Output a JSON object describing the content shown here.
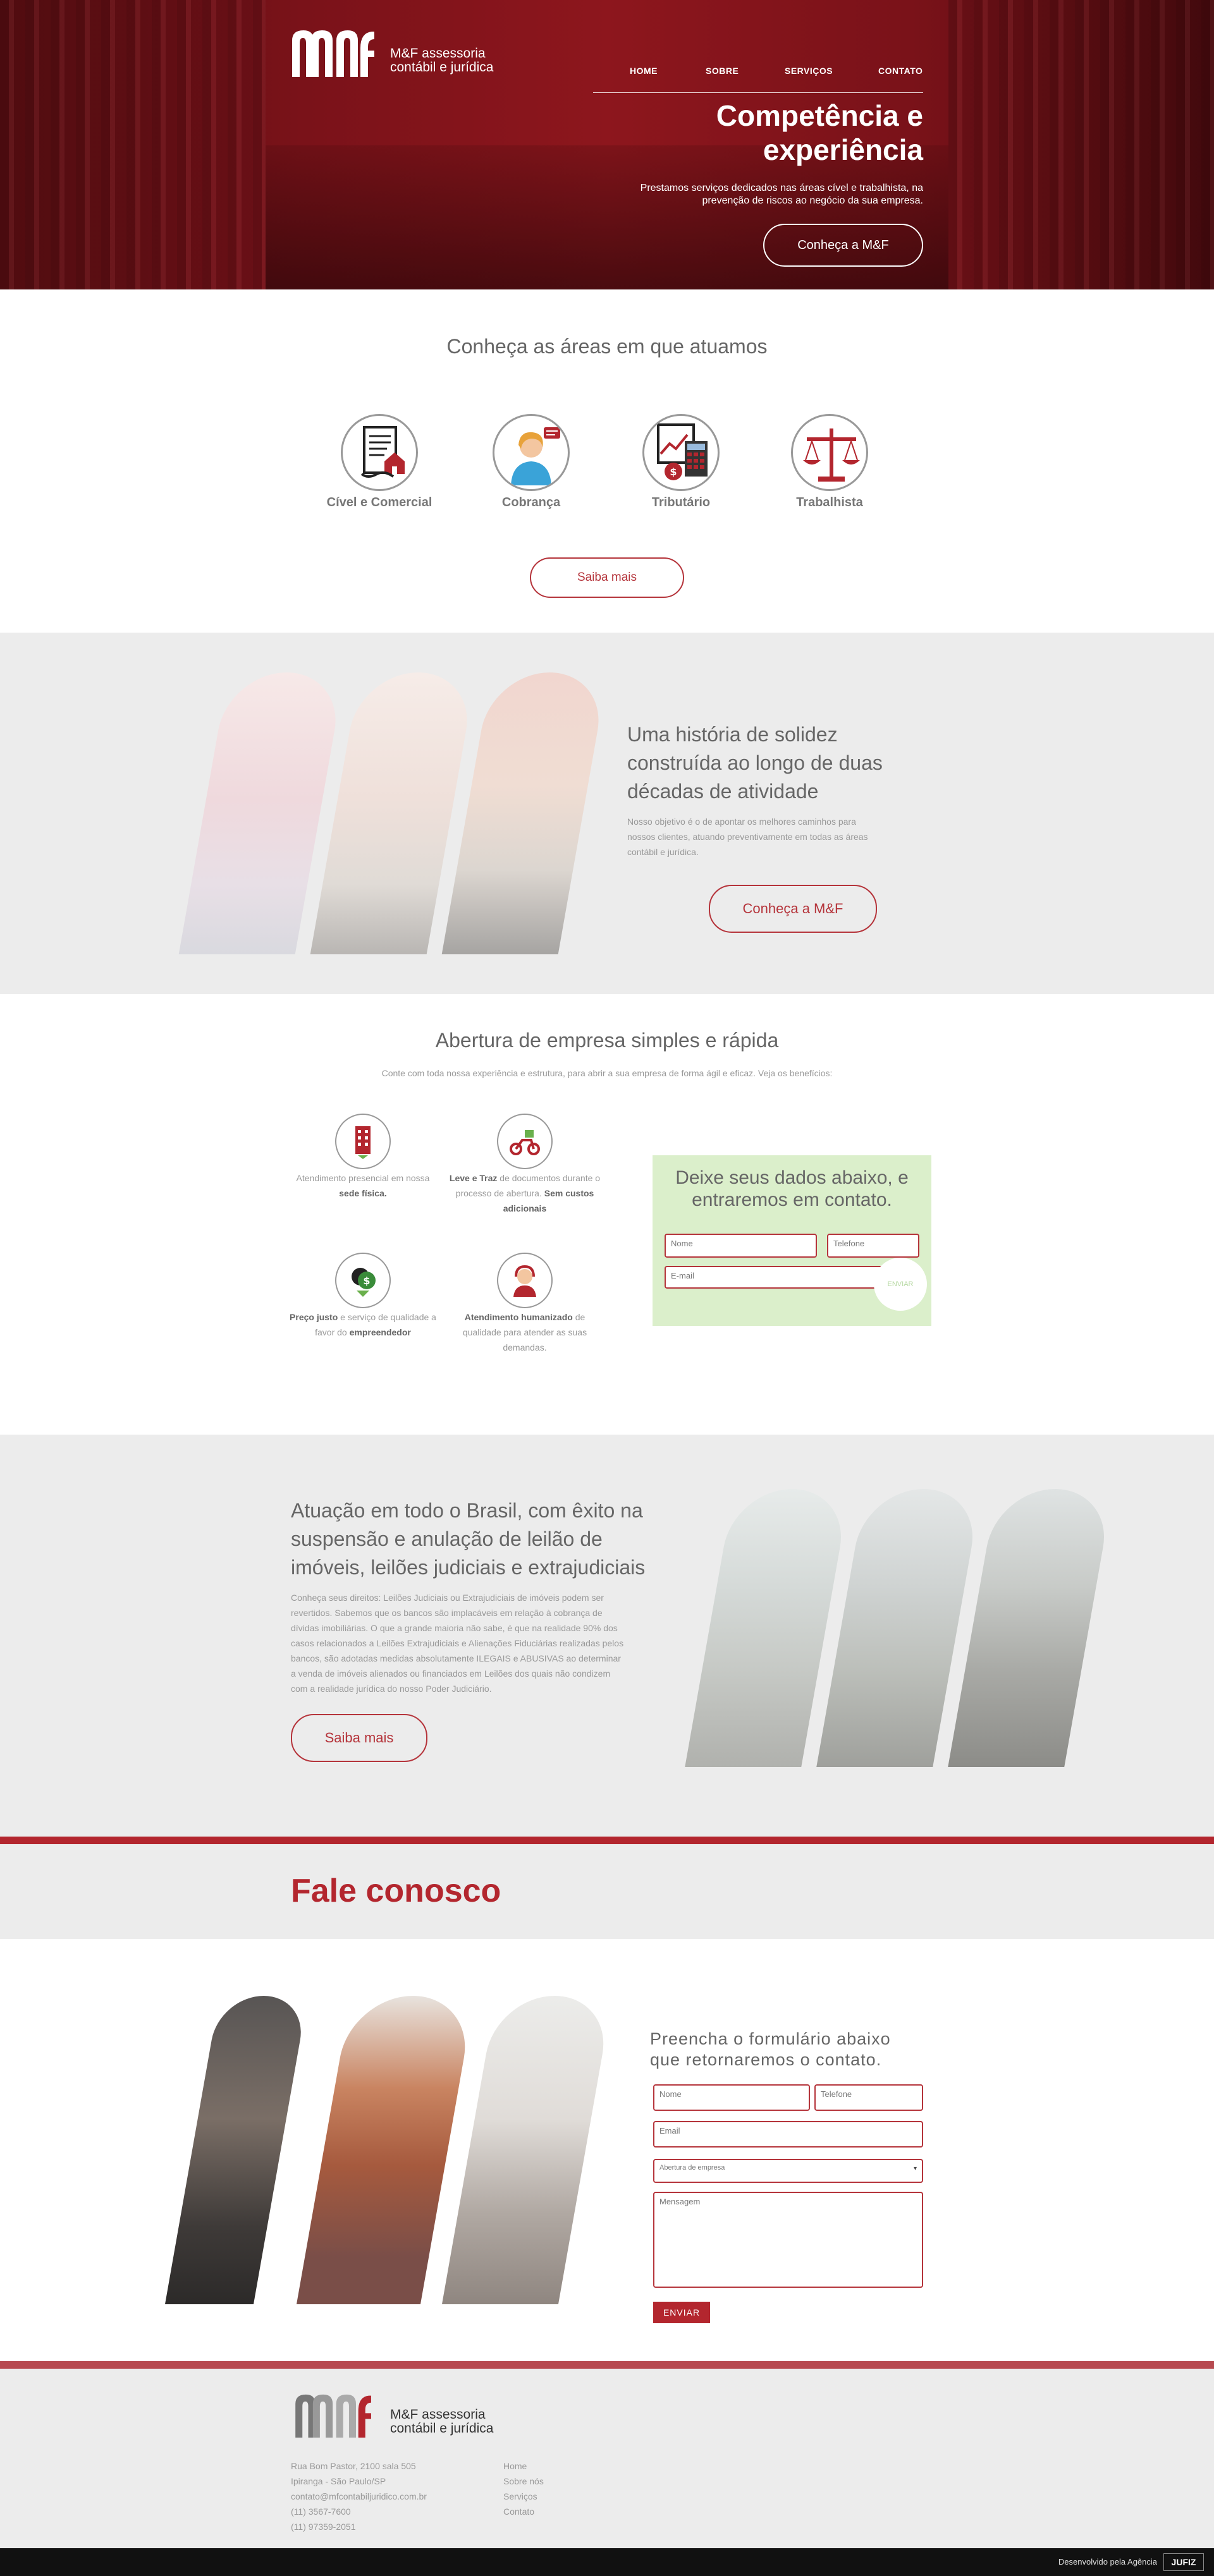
{
  "brand": {
    "logo_letters": "mf",
    "name_line1": "M&F assessoria",
    "name_line2": "contábil e jurídica"
  },
  "nav": {
    "items": [
      {
        "label": "HOME"
      },
      {
        "label": "SOBRE"
      },
      {
        "label": "SERVIÇOS"
      },
      {
        "label": "CONTATO"
      }
    ]
  },
  "hero": {
    "title_line1": "Competência e",
    "title_line2": "experiência",
    "subtitle_line1": "Prestamos serviços dedicados nas áreas cível e trabalhista, na",
    "subtitle_line2": "prevenção de riscos ao negócio da sua empresa.",
    "button": "Conheça a M&F"
  },
  "areas": {
    "title": "Conheça as áreas em que atuamos",
    "items": [
      {
        "label": "Cível e Comercial",
        "icon": "contract-house-icon"
      },
      {
        "label": "Cobrança",
        "icon": "collector-person-icon"
      },
      {
        "label": "Tributário",
        "icon": "calculator-document-icon"
      },
      {
        "label": "Trabalhista",
        "icon": "scales-icon"
      }
    ],
    "button": "Saiba mais"
  },
  "historia": {
    "title_line1": "Uma história de solidez",
    "title_line2": "construída ao longo de duas",
    "title_line3": "décadas de atividade",
    "text_line1": "Nosso objetivo é o de apontar os melhores caminhos para",
    "text_line2": "nossos clientes, atuando preventivamente em todas as áreas",
    "text_line3": "contábil e jurídica.",
    "button": "Conheça a M&F"
  },
  "abertura": {
    "title": "Abertura de empresa simples e rápida",
    "subtitle": "Conte com toda nossa experiência e estrutura, para abrir a sua empresa de forma ágil e eficaz. Veja os benefícios:",
    "features": [
      {
        "pre": "Atendimento presencial em nossa ",
        "bold": "sede física.",
        "post": "",
        "bold2": ""
      },
      {
        "pre": "",
        "bold": "Leve e Traz",
        "post": " de documentos durante o processo de abertura. ",
        "bold2": "Sem custos adicionais"
      },
      {
        "pre": "",
        "bold": "Preço justo",
        "post": " e serviço de qualidade a favor do ",
        "bold2": "empreendedor"
      },
      {
        "pre": "",
        "bold": "Atendimento humanizado",
        "post": " de qualidade para atender as suas demandas.",
        "bold2": ""
      }
    ],
    "form": {
      "title_line1": "Deixe seus dados abaixo, e",
      "title_line2": "entraremos em contato.",
      "name_placeholder": "Nome",
      "phone_placeholder": "Telefone",
      "email_placeholder": "E-mail",
      "send": "ENVIAR"
    }
  },
  "atuacao": {
    "title_line1": "Atuação em todo o Brasil, com êxito na",
    "title_line2": "suspensão e anulação de leilão de",
    "title_line3": "imóveis, leilões judiciais e extrajudiciais",
    "text": [
      "Conheça seus direitos: Leilões Judiciais ou Extrajudiciais de imóveis podem ser",
      "revertidos. Sabemos que os bancos são implacáveis em relação à cobrança de",
      "dívidas imobiliárias. O que a grande maioria não sabe, é que na realidade 90% dos",
      "casos relacionados a Leilões Extrajudiciais e Alienações Fiduciárias realizadas pelos",
      "bancos, são adotadas medidas absolutamente ILEGAIS e ABUSIVAS ao determinar",
      "a venda de imóveis alienados ou financiados em Leilões dos quais não condizem",
      "com a realidade jurídica do nosso Poder Judiciário."
    ],
    "button": "Saiba mais"
  },
  "fale": {
    "title": "Fale conosco",
    "form_title_line1": "Preencha o formulário abaixo",
    "form_title_line2": "que retornaremos o contato.",
    "name_placeholder": "Nome",
    "phone_placeholder": "Telefone",
    "email_placeholder": "Email",
    "subject_selected": "Abertura de empresa",
    "message_placeholder": "Mensagem",
    "send": "ENVIAR"
  },
  "footer": {
    "address": [
      "Rua Bom Pastor, 2100 sala 505",
      "Ipiranga - São Paulo/SP",
      "contato@mfcontabiljuridico.com.br",
      "(11) 3567-7600",
      "(11) 97359-2051"
    ],
    "links": [
      "Home",
      "Sobre nós",
      "Serviços",
      "Contato"
    ],
    "credit": "Desenvolvido pela Agência",
    "agency": "JUFIZ"
  },
  "colors": {
    "brand_red": "#b3262e",
    "light_green": "#dbefcb",
    "band_gray": "#ececec"
  }
}
